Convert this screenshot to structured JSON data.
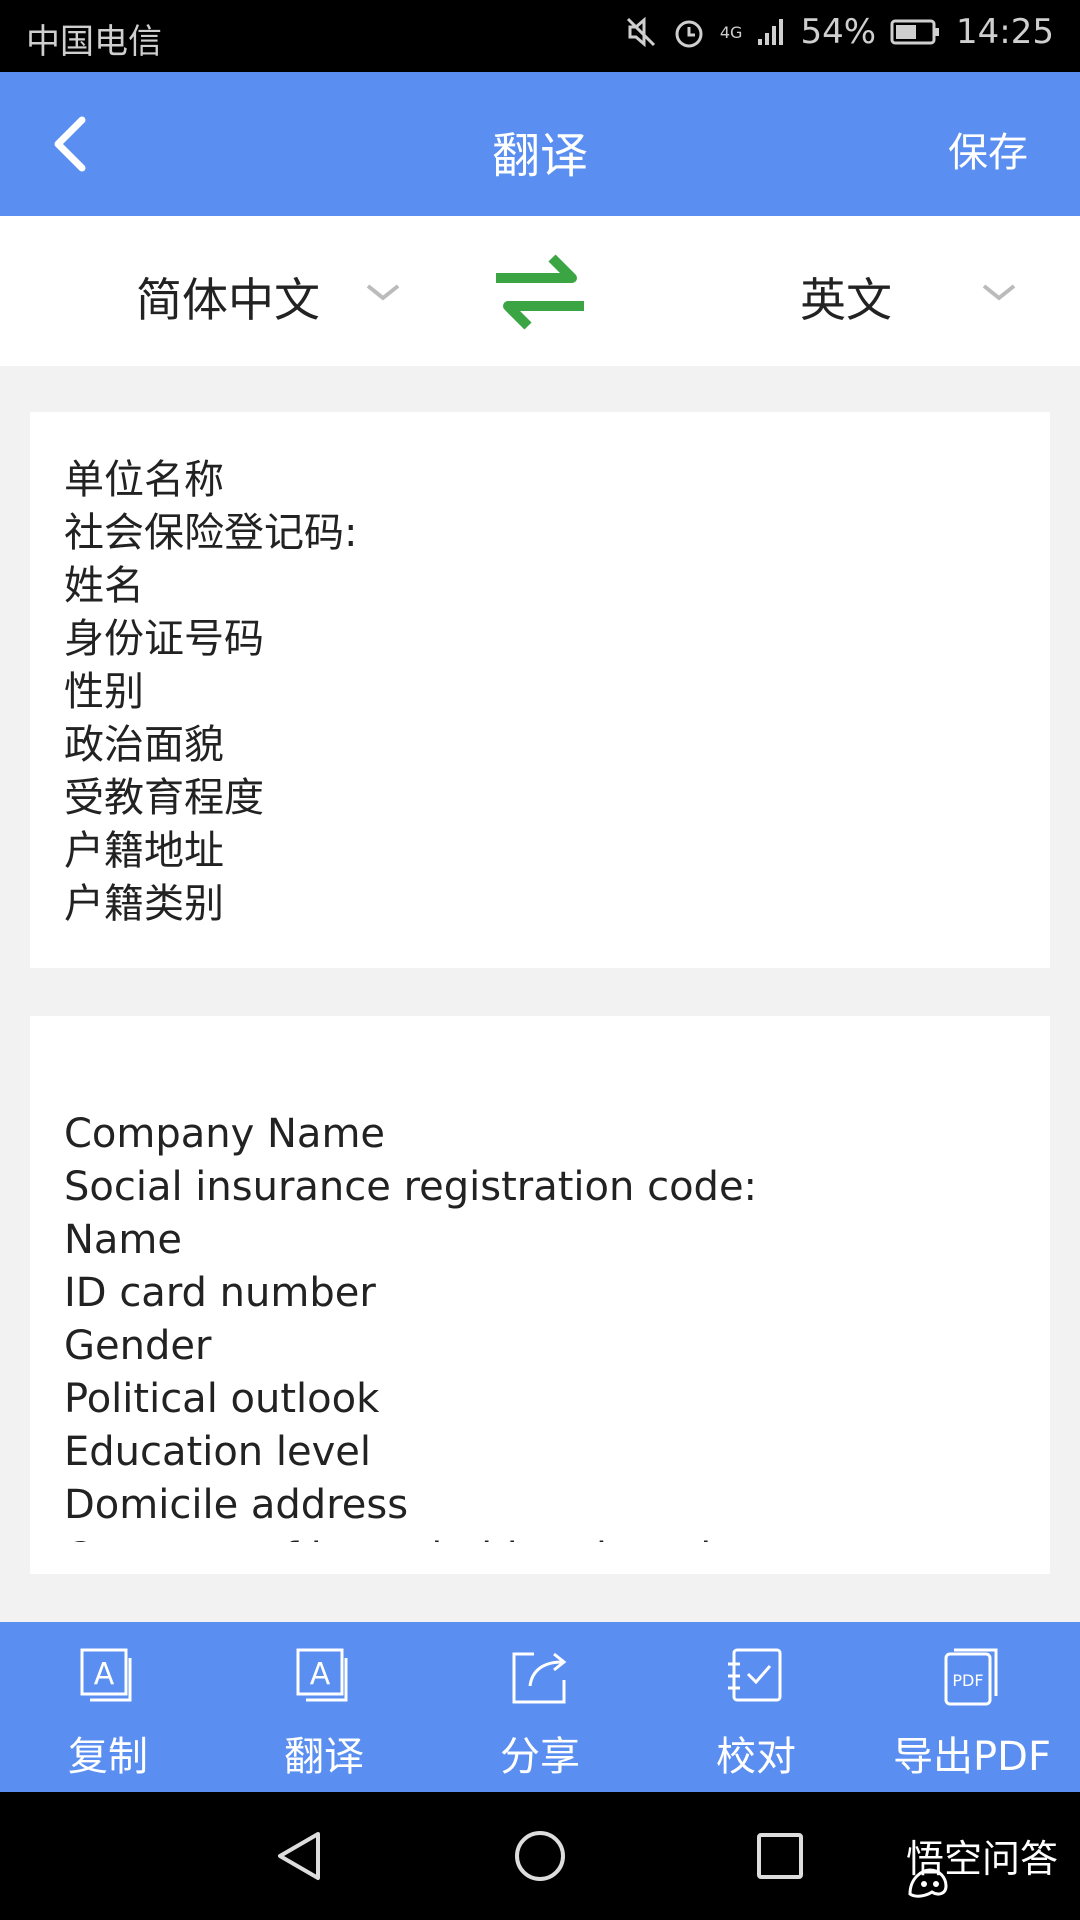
{
  "status_bar": {
    "carrier": "中国电信",
    "network": "4G",
    "battery": "54%",
    "time": "14:25"
  },
  "header": {
    "title": "翻译",
    "save_label": "保存"
  },
  "language_bar": {
    "source_language": "简体中文",
    "target_language": "英文",
    "accent_color": "#3aa542"
  },
  "source_text": {
    "lines": [
      "单位名称",
      "社会保险登记码:",
      "姓名",
      "身份证号码",
      "性别",
      "政治面貌",
      "受教育程度",
      "户籍地址",
      "户籍类别"
    ]
  },
  "translated_text": {
    "lines": [
      "Company Name",
      "Social insurance registration code:",
      "Name",
      "ID card number",
      "Gender",
      "Political outlook",
      "Education level",
      "Domicile address",
      "Category of household registration"
    ]
  },
  "toolbar": {
    "items": [
      {
        "label": "复制",
        "icon": "copy-icon"
      },
      {
        "label": "翻译",
        "icon": "translate-icon"
      },
      {
        "label": "分享",
        "icon": "share-icon"
      },
      {
        "label": "校对",
        "icon": "proofread-icon"
      },
      {
        "label": "导出PDF",
        "icon": "export-pdf-icon"
      }
    ]
  },
  "watermark": {
    "text": "悟空问答"
  },
  "colors": {
    "primary": "#5a8ef0",
    "background": "#f2f2f2"
  }
}
